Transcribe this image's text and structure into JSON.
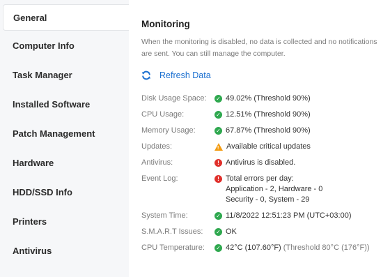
{
  "sidebar": {
    "items": [
      {
        "label": "General",
        "active": true
      },
      {
        "label": "Computer Info"
      },
      {
        "label": "Task Manager"
      },
      {
        "label": "Installed Software"
      },
      {
        "label": "Patch Management"
      },
      {
        "label": "Hardware"
      },
      {
        "label": "HDD/SSD Info"
      },
      {
        "label": "Printers"
      },
      {
        "label": "Antivirus"
      }
    ]
  },
  "main": {
    "title": "Monitoring",
    "description": "When the monitoring is disabled, no data is collected and no notifications are sent. You can still manage the computer.",
    "refresh_label": "Refresh Data",
    "rows": {
      "disk": {
        "label": "Disk Usage Space:",
        "value": "49.02%",
        "threshold": "(Threshold 90%)",
        "status": "ok"
      },
      "cpu": {
        "label": "CPU Usage:",
        "value": "12.51%",
        "threshold": "(Threshold 90%)",
        "status": "ok"
      },
      "memory": {
        "label": "Memory Usage:",
        "value": "67.87%",
        "threshold": "(Threshold 90%)",
        "status": "ok"
      },
      "updates": {
        "label": "Updates:",
        "value": "Available critical updates",
        "status": "warning"
      },
      "antivirus": {
        "label": "Antivirus:",
        "value": "Antivirus is disabled.",
        "status": "error"
      },
      "eventlog": {
        "label": "Event Log:",
        "line1": "Total errors per day:",
        "line2": "Application - 2, Hardware - 0",
        "line3": "Security - 0, System - 29",
        "status": "error"
      },
      "systemtime": {
        "label": "System Time:",
        "value": "11/8/2022 12:51:23 PM (UTC+03:00)",
        "status": "ok"
      },
      "smart": {
        "label": "S.M.A.R.T Issues:",
        "value": "OK",
        "status": "ok"
      },
      "cputemp": {
        "label": "CPU Temperature:",
        "value": "42°C (107.60°F)",
        "threshold": "(Threshold 80°C (176°F))",
        "status": "ok"
      }
    }
  },
  "colors": {
    "ok": "#2fa84f",
    "error": "#e0302b",
    "warning": "#f39c12",
    "link": "#1a6fd0"
  }
}
